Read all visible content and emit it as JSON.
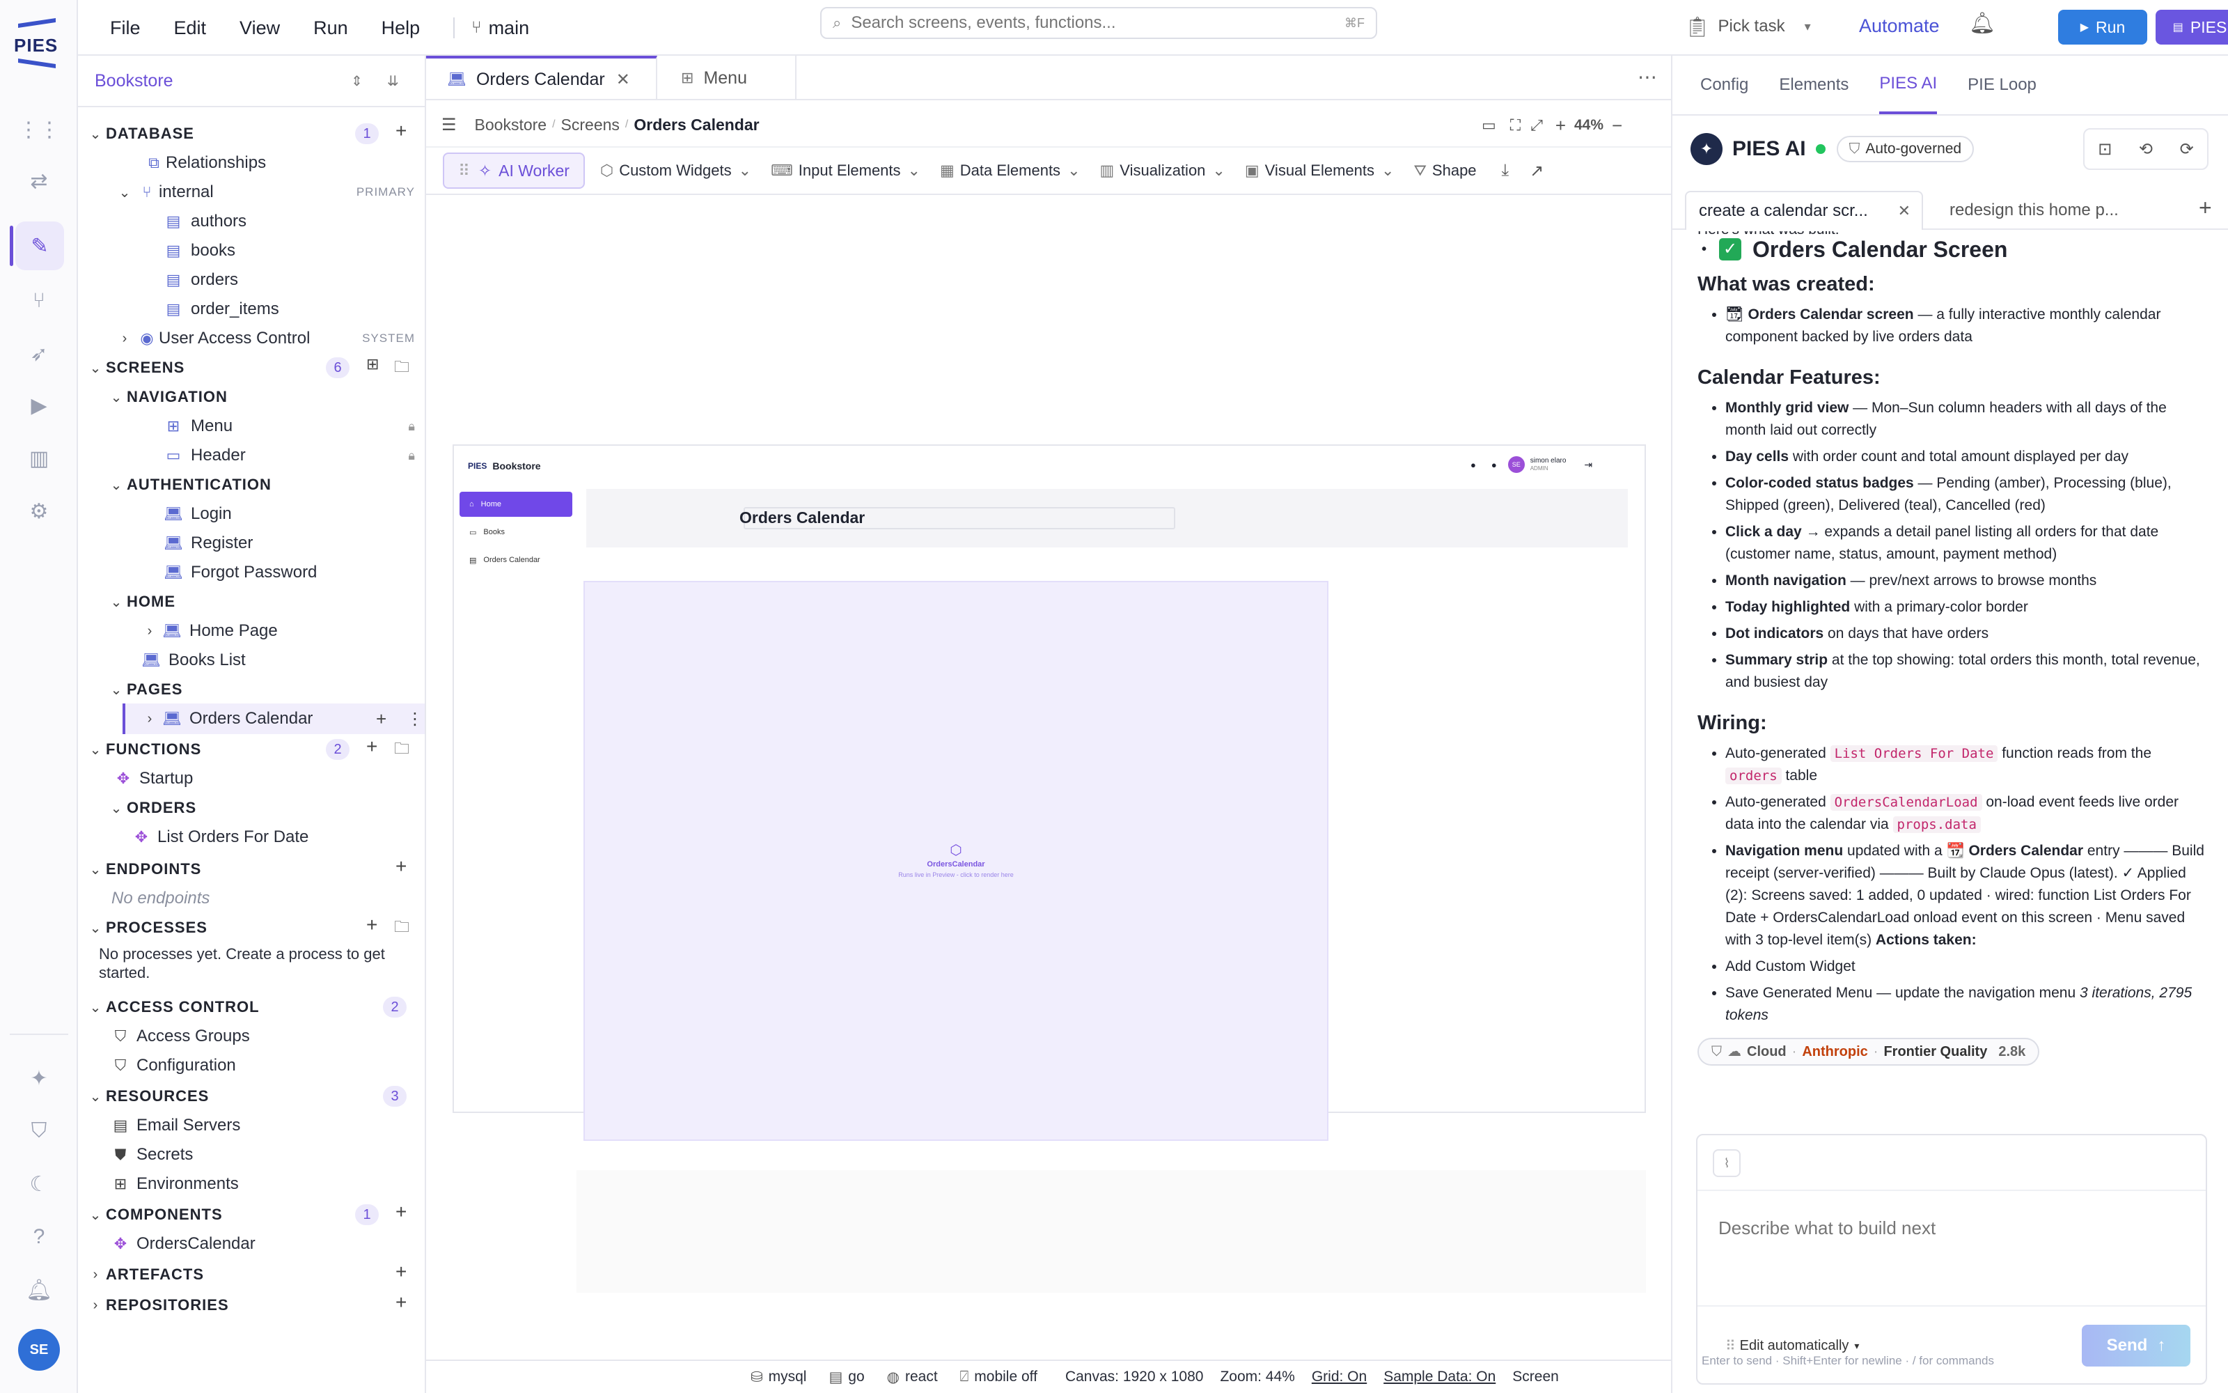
{
  "app": {
    "logo": "PIES",
    "branch": "main",
    "search_placeholder": "Search screens, events, functions...",
    "search_shortcut": "⌘F",
    "pick_task": "Pick task",
    "automate": "Automate",
    "run": "Run",
    "pies_ai": "PIES AI"
  },
  "menu": [
    "File",
    "Edit",
    "View",
    "Run",
    "Help"
  ],
  "rail": {
    "avatar": "SE"
  },
  "tree": {
    "project": "Bookstore",
    "database": {
      "label": "DATABASE",
      "count": "1",
      "relationships": "Relationships",
      "internal": "internal",
      "primary": "PRIMARY",
      "tables": [
        "authors",
        "books",
        "orders",
        "order_items"
      ],
      "uac": "User Access Control",
      "system": "SYSTEM"
    },
    "screens": {
      "label": "SCREENS",
      "count": "6",
      "navigation": "NAVIGATION",
      "menu": "Menu",
      "header": "Header",
      "authentication": "AUTHENTICATION",
      "login": "Login",
      "register": "Register",
      "forgot": "Forgot Password",
      "home": "HOME",
      "home_page": "Home Page",
      "books_list": "Books List",
      "pages": "PAGES",
      "orders_calendar": "Orders Calendar"
    },
    "functions": {
      "label": "FUNCTIONS",
      "count": "2",
      "startup": "Startup",
      "orders": "ORDERS",
      "list_orders": "List Orders For Date"
    },
    "endpoints": {
      "label": "ENDPOINTS",
      "empty": "No endpoints"
    },
    "processes": {
      "label": "PROCESSES",
      "empty": "No processes yet. Create a process to get started."
    },
    "access": {
      "label": "ACCESS CONTROL",
      "count": "2",
      "groups": "Access Groups",
      "config": "Configuration"
    },
    "resources": {
      "label": "RESOURCES",
      "count": "3",
      "email": "Email Servers",
      "secrets": "Secrets",
      "env": "Environments"
    },
    "components": {
      "label": "COMPONENTS",
      "count": "1",
      "orders_calendar": "OrdersCalendar"
    },
    "artefacts": "ARTEFACTS",
    "repositories": "REPOSITORIES"
  },
  "center": {
    "tabs": [
      "Orders Calendar",
      "Menu"
    ],
    "breadcrumb": [
      "Bookstore",
      "Screens",
      "Orders Calendar"
    ],
    "zoom": "44%",
    "toolbar": {
      "ai_worker": "AI Worker",
      "custom": "Custom Widgets",
      "input": "Input Elements",
      "data": "Data Elements",
      "viz": "Visualization",
      "visual": "Visual Elements",
      "shape": "Shape"
    },
    "preview": {
      "brand": "Bookstore",
      "user": "simon elaro",
      "role": "ADMIN",
      "avatar": "SE",
      "nav": [
        "Home",
        "Books",
        "Orders Calendar"
      ],
      "title": "Orders Calendar",
      "widget": "OrdersCalendar",
      "widget_hint": "Runs live in Preview - click to render here"
    },
    "status": {
      "db": "mysql",
      "lang": "go",
      "fw": "react",
      "mobile": "mobile off",
      "canvas": "Canvas: 1920 x 1080",
      "zoom": "Zoom: 44%",
      "grid": "Grid: On",
      "sample": "Sample Data: On",
      "screen": "Screen"
    }
  },
  "right": {
    "tabs": [
      "Config",
      "Elements",
      "PIES AI",
      "PIE Loop"
    ],
    "title": "PIES AI",
    "governed": "Auto-governed",
    "chats": [
      "create a calendar scr...",
      "redesign this home p..."
    ],
    "peek": "Here's what was built:",
    "heading": "Orders Calendar Screen",
    "created_h": "What was created:",
    "created_item_b": "Orders Calendar screen",
    "created_item": " — a fully interactive monthly calendar component backed by live orders data",
    "features_h": "Calendar Features:",
    "features": [
      {
        "b": "Monthly grid view",
        "t": " — Mon–Sun column headers with all days of the month laid out correctly"
      },
      {
        "b": "Day cells",
        "t": " with order count and total amount displayed per day"
      },
      {
        "b": "Color-coded status badges",
        "t": " — Pending (amber), Processing (blue), Shipped (green), Delivered (teal), Cancelled (red)"
      },
      {
        "b": "Click a day",
        "t": " → expands a detail panel listing all orders for that date (customer name, status, amount, payment method)"
      },
      {
        "b": "Month navigation",
        "t": " — prev/next arrows to browse months"
      },
      {
        "b": "Today highlighted",
        "t": " with a primary-color border"
      },
      {
        "b": "Dot indicators",
        "t": " on days that have orders"
      },
      {
        "b": "Summary strip",
        "t": " at the top showing: total orders this month, total revenue, and busiest day"
      }
    ],
    "wiring_h": "Wiring:",
    "w1a": "Auto-generated ",
    "w1c": "List Orders For Date",
    "w1b": " function reads from the ",
    "w1d": "orders",
    "w1e": " table",
    "w2a": "Auto-generated ",
    "w2c": "OrdersCalendarLoad",
    "w2b": " on-load event feeds live order data into the calendar via ",
    "w2d": "props.data",
    "w3b": "Navigation menu",
    "w3a": " updated with a 📆 ",
    "w3c": "Orders Calendar",
    "w3d": " entry ——— Build receipt (server-verified) ——— Built by Claude Opus (latest). ✓ Applied (2): Screens saved: 1 added, 0 updated · wired: function List Orders For Date + OrdersCalendarLoad onload event on this screen · Menu saved with 3 top-level item(s) ",
    "w3e": "Actions taken:",
    "act1": "Add Custom Widget",
    "act2": "Save Generated Menu — update the navigation menu ",
    "act2i": "3 iterations, 2795 tokens",
    "model": {
      "cloud": "Cloud",
      "provider": "Anthropic",
      "quality": "Frontier Quality",
      "tokens": "2.8k"
    },
    "input_placeholder": "Describe what to build next",
    "edit_mode": "Edit automatically",
    "send": "Send",
    "hint": "Enter to send · Shift+Enter for newline · / for commands"
  }
}
